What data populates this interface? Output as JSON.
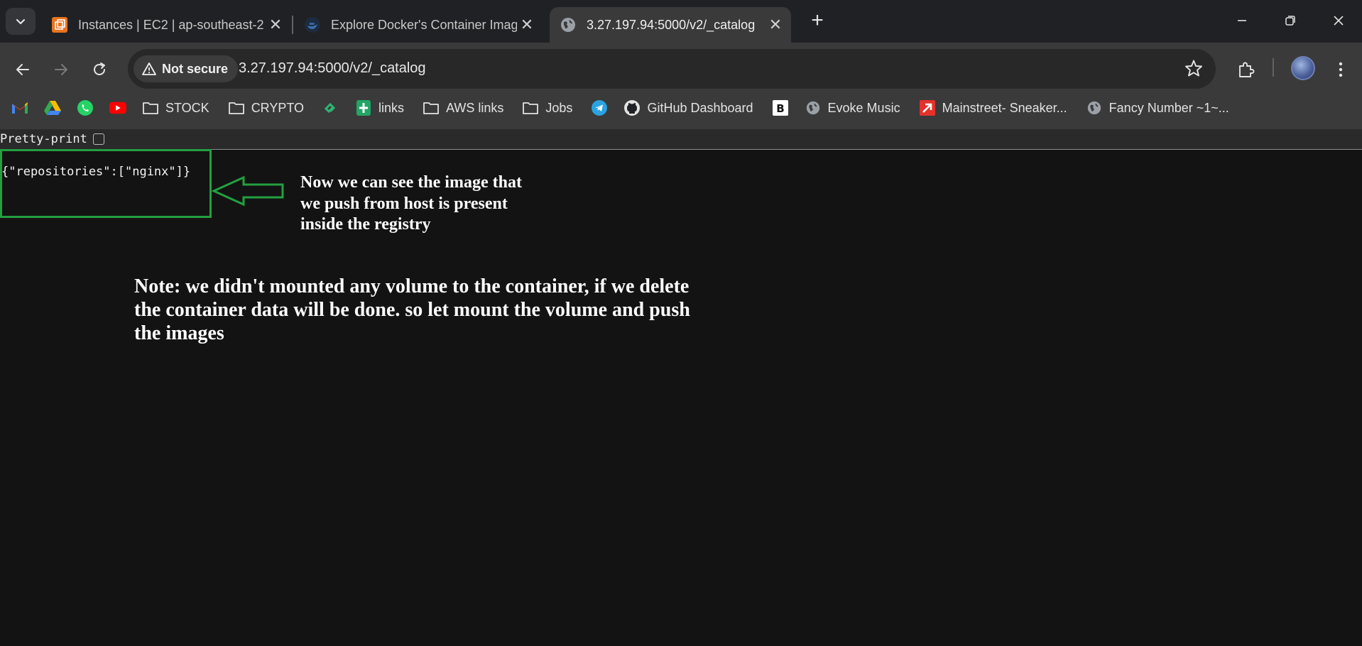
{
  "tabs": [
    {
      "title": "Instances | EC2 | ap-southeast-2",
      "favicon": "aws-ec2-icon",
      "active": false
    },
    {
      "title": "Explore Docker's Container Images",
      "favicon": "docker-icon",
      "active": false
    },
    {
      "title": "3.27.197.94:5000/v2/_catalog",
      "favicon": "globe-icon",
      "active": true
    }
  ],
  "address_bar": {
    "security_label": "Not secure",
    "url": "3.27.197.94:5000/v2/_catalog"
  },
  "bookmarks": [
    {
      "label": "",
      "icon": "gmail-icon"
    },
    {
      "label": "",
      "icon": "google-drive-icon"
    },
    {
      "label": "",
      "icon": "whatsapp-icon"
    },
    {
      "label": "",
      "icon": "youtube-icon"
    },
    {
      "label": "STOCK",
      "icon": "folder-icon"
    },
    {
      "label": "CRYPTO",
      "icon": "folder-icon"
    },
    {
      "label": "",
      "icon": "green-logo-icon"
    },
    {
      "label": "links",
      "icon": "google-sheets-icon"
    },
    {
      "label": "AWS links",
      "icon": "folder-icon"
    },
    {
      "label": "Jobs",
      "icon": "folder-icon"
    },
    {
      "label": "",
      "icon": "telegram-icon"
    },
    {
      "label": "GitHub Dashboard",
      "icon": "github-icon"
    },
    {
      "label": "",
      "icon": "b-logo-icon"
    },
    {
      "label": "Evoke Music",
      "icon": "globe-icon"
    },
    {
      "label": "Mainstreet- Sneaker...",
      "icon": "red-arrow-icon"
    },
    {
      "label": "Fancy Number ~1~...",
      "icon": "globe-icon"
    }
  ],
  "page": {
    "pretty_print_label": "Pretty-print",
    "pretty_print_checked": false,
    "json_response": "{\"repositories\":[\"nginx\"]}"
  },
  "annotations": {
    "note_right": "Now we can see the image that\nwe push from host is present\ninside the registry",
    "note_bottom": "Note: we didn't mounted any volume to the container, if we delete\nthe container data will be done. so let mount the volume and push\nthe images",
    "highlight_color": "#23a040"
  },
  "colors": {
    "tabstrip_bg": "#202124",
    "toolbar_bg": "#3a3a3a",
    "page_bg": "#131313"
  }
}
